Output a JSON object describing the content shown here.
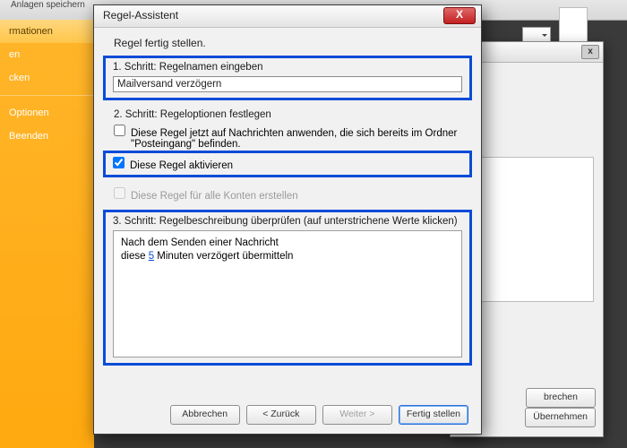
{
  "ribbon": {
    "fragment": "Anlagen speichern"
  },
  "side_menu": {
    "items": [
      {
        "label": "rmationen",
        "selected": true
      },
      {
        "label": "en"
      },
      {
        "label": "cken"
      }
    ],
    "opt": "Optionen",
    "exit": "Beenden"
  },
  "back_dialog": {
    "close_glyph": "x",
    "buttons": {
      "cancel": "brechen",
      "apply": "Übernehmen"
    }
  },
  "dialog": {
    "title": "Regel-Assistent",
    "close_glyph": "X",
    "subtitle": "Regel fertig stellen.",
    "step1": {
      "label": "1. Schritt: Regelnamen eingeben",
      "value": "Mailversand verzögern"
    },
    "step2": {
      "label": "2. Schritt: Regeloptionen festlegen",
      "apply_now": "Diese Regel jetzt auf Nachrichten anwenden, die sich bereits im Ordner \"Posteingang\" befinden.",
      "activate": "Diese Regel aktivieren",
      "all_accounts": "Diese Regel für alle Konten erstellen",
      "apply_now_checked": false,
      "activate_checked": true,
      "all_accounts_enabled": false
    },
    "step3": {
      "label": "3. Schritt: Regelbeschreibung überprüfen (auf unterstrichene Werte klicken)",
      "line1": "Nach dem Senden einer Nachricht",
      "line2_a": "diese ",
      "line2_link": "5",
      "line2_b": " Minuten verzögert übermitteln"
    },
    "buttons": {
      "cancel": "Abbrechen",
      "back": "< Zurück",
      "next": "Weiter >",
      "finish": "Fertig stellen"
    }
  }
}
